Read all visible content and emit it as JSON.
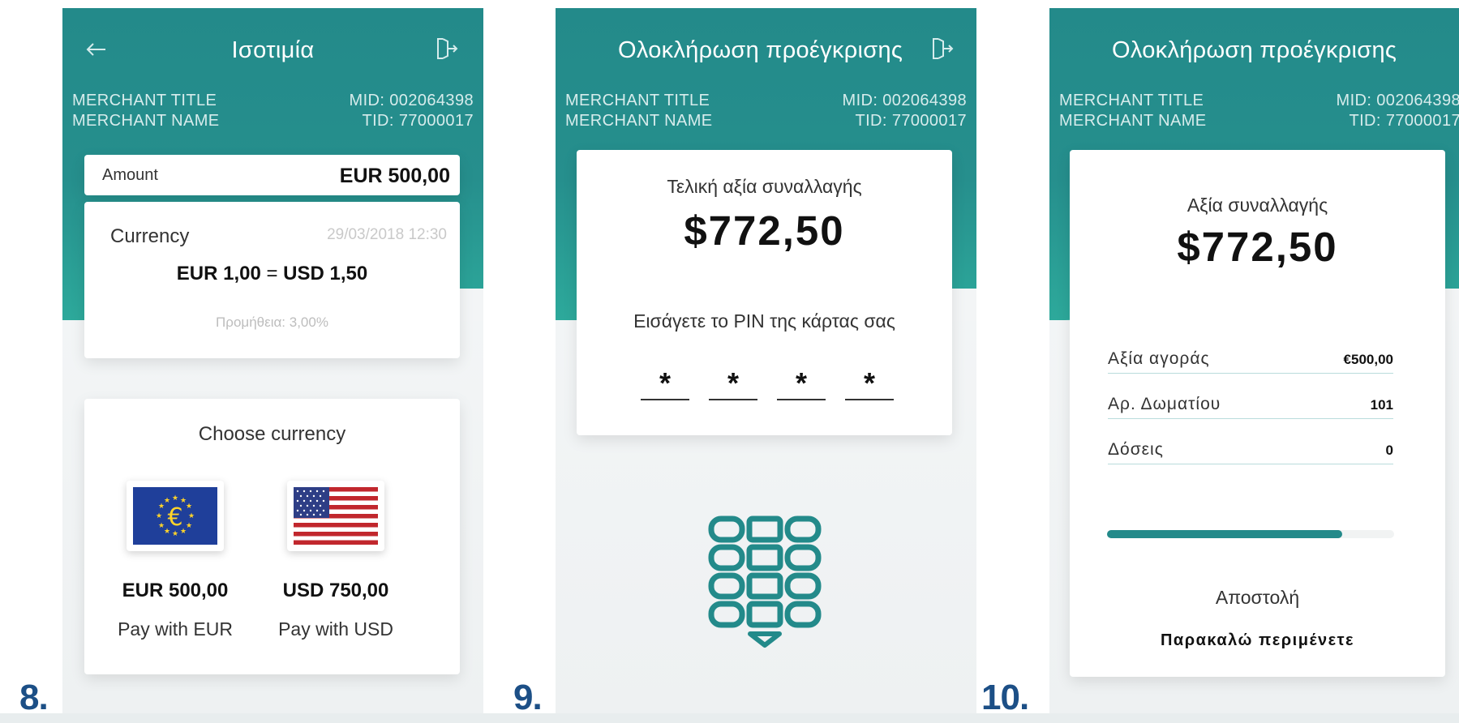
{
  "steps": {
    "s8": "8.",
    "s9": "9.",
    "s10": "10."
  },
  "colors": {
    "header": "#238a8a",
    "accent": "#238a8a",
    "step_number": "#1c4f86"
  },
  "merchant": {
    "title": "MERCHANT TITLE",
    "name": "MERCHANT NAME",
    "mid": "MID: 002064398",
    "tid": "TID: 77000017"
  },
  "screen8": {
    "title": "Ισοτιμία",
    "icons": [
      "arrow-left-icon",
      "exit-icon"
    ],
    "amount_label": "Amount",
    "amount_value": "EUR 500,00",
    "currency_label": "Currency",
    "datetime": "29/03/2018 12:30",
    "rate_left": "EUR 1,00",
    "rate_eq": "=",
    "rate_right": "USD 1,50",
    "fee": "Προμήθεια: 3,00%",
    "choose_heading": "Choose currency",
    "options": [
      {
        "flag": "eu-flag-icon",
        "amount": "EUR 500,00",
        "pay": "Pay with EUR"
      },
      {
        "flag": "us-flag-icon",
        "amount": "USD 750,00",
        "pay": "Pay with USD"
      }
    ]
  },
  "screen9": {
    "title": "Ολοκλήρωση προέγκρισης",
    "icons": [
      "exit-icon",
      "keypad-icon"
    ],
    "final_label": "Τελική αξία συναλλαγής",
    "final_amount": "$772,50",
    "pin_prompt": "Εισάγετε το PIN της κάρτας σας",
    "pin_digits": [
      "*",
      "*",
      "*",
      "*"
    ]
  },
  "screen10": {
    "title": "Ολοκλήρωση προέγκρισης",
    "amount_label": "Αξία συναλλαγής",
    "amount": "$772,50",
    "rows": [
      {
        "key": "Αξία αγοράς",
        "value": "€500,00"
      },
      {
        "key": "Αρ. Δωματίου",
        "value": "101"
      },
      {
        "key": "Δόσεις",
        "value": "0"
      }
    ],
    "progress_fraction": 0.82,
    "status": "Αποστολή",
    "wait": "Παρακαλώ περιμένετε"
  }
}
